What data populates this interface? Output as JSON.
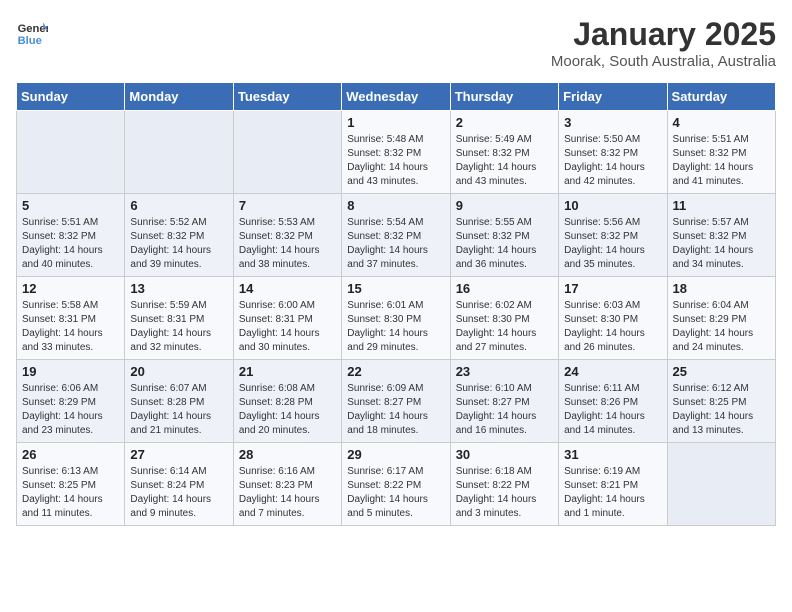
{
  "logo": {
    "line1": "General",
    "line2": "Blue"
  },
  "title": "January 2025",
  "subtitle": "Moorak, South Australia, Australia",
  "headers": [
    "Sunday",
    "Monday",
    "Tuesday",
    "Wednesday",
    "Thursday",
    "Friday",
    "Saturday"
  ],
  "weeks": [
    [
      {
        "day": "",
        "info": ""
      },
      {
        "day": "",
        "info": ""
      },
      {
        "day": "",
        "info": ""
      },
      {
        "day": "1",
        "info": "Sunrise: 5:48 AM\nSunset: 8:32 PM\nDaylight: 14 hours and 43 minutes."
      },
      {
        "day": "2",
        "info": "Sunrise: 5:49 AM\nSunset: 8:32 PM\nDaylight: 14 hours and 43 minutes."
      },
      {
        "day": "3",
        "info": "Sunrise: 5:50 AM\nSunset: 8:32 PM\nDaylight: 14 hours and 42 minutes."
      },
      {
        "day": "4",
        "info": "Sunrise: 5:51 AM\nSunset: 8:32 PM\nDaylight: 14 hours and 41 minutes."
      }
    ],
    [
      {
        "day": "5",
        "info": "Sunrise: 5:51 AM\nSunset: 8:32 PM\nDaylight: 14 hours and 40 minutes."
      },
      {
        "day": "6",
        "info": "Sunrise: 5:52 AM\nSunset: 8:32 PM\nDaylight: 14 hours and 39 minutes."
      },
      {
        "day": "7",
        "info": "Sunrise: 5:53 AM\nSunset: 8:32 PM\nDaylight: 14 hours and 38 minutes."
      },
      {
        "day": "8",
        "info": "Sunrise: 5:54 AM\nSunset: 8:32 PM\nDaylight: 14 hours and 37 minutes."
      },
      {
        "day": "9",
        "info": "Sunrise: 5:55 AM\nSunset: 8:32 PM\nDaylight: 14 hours and 36 minutes."
      },
      {
        "day": "10",
        "info": "Sunrise: 5:56 AM\nSunset: 8:32 PM\nDaylight: 14 hours and 35 minutes."
      },
      {
        "day": "11",
        "info": "Sunrise: 5:57 AM\nSunset: 8:32 PM\nDaylight: 14 hours and 34 minutes."
      }
    ],
    [
      {
        "day": "12",
        "info": "Sunrise: 5:58 AM\nSunset: 8:31 PM\nDaylight: 14 hours and 33 minutes."
      },
      {
        "day": "13",
        "info": "Sunrise: 5:59 AM\nSunset: 8:31 PM\nDaylight: 14 hours and 32 minutes."
      },
      {
        "day": "14",
        "info": "Sunrise: 6:00 AM\nSunset: 8:31 PM\nDaylight: 14 hours and 30 minutes."
      },
      {
        "day": "15",
        "info": "Sunrise: 6:01 AM\nSunset: 8:30 PM\nDaylight: 14 hours and 29 minutes."
      },
      {
        "day": "16",
        "info": "Sunrise: 6:02 AM\nSunset: 8:30 PM\nDaylight: 14 hours and 27 minutes."
      },
      {
        "day": "17",
        "info": "Sunrise: 6:03 AM\nSunset: 8:30 PM\nDaylight: 14 hours and 26 minutes."
      },
      {
        "day": "18",
        "info": "Sunrise: 6:04 AM\nSunset: 8:29 PM\nDaylight: 14 hours and 24 minutes."
      }
    ],
    [
      {
        "day": "19",
        "info": "Sunrise: 6:06 AM\nSunset: 8:29 PM\nDaylight: 14 hours and 23 minutes."
      },
      {
        "day": "20",
        "info": "Sunrise: 6:07 AM\nSunset: 8:28 PM\nDaylight: 14 hours and 21 minutes."
      },
      {
        "day": "21",
        "info": "Sunrise: 6:08 AM\nSunset: 8:28 PM\nDaylight: 14 hours and 20 minutes."
      },
      {
        "day": "22",
        "info": "Sunrise: 6:09 AM\nSunset: 8:27 PM\nDaylight: 14 hours and 18 minutes."
      },
      {
        "day": "23",
        "info": "Sunrise: 6:10 AM\nSunset: 8:27 PM\nDaylight: 14 hours and 16 minutes."
      },
      {
        "day": "24",
        "info": "Sunrise: 6:11 AM\nSunset: 8:26 PM\nDaylight: 14 hours and 14 minutes."
      },
      {
        "day": "25",
        "info": "Sunrise: 6:12 AM\nSunset: 8:25 PM\nDaylight: 14 hours and 13 minutes."
      }
    ],
    [
      {
        "day": "26",
        "info": "Sunrise: 6:13 AM\nSunset: 8:25 PM\nDaylight: 14 hours and 11 minutes."
      },
      {
        "day": "27",
        "info": "Sunrise: 6:14 AM\nSunset: 8:24 PM\nDaylight: 14 hours and 9 minutes."
      },
      {
        "day": "28",
        "info": "Sunrise: 6:16 AM\nSunset: 8:23 PM\nDaylight: 14 hours and 7 minutes."
      },
      {
        "day": "29",
        "info": "Sunrise: 6:17 AM\nSunset: 8:22 PM\nDaylight: 14 hours and 5 minutes."
      },
      {
        "day": "30",
        "info": "Sunrise: 6:18 AM\nSunset: 8:22 PM\nDaylight: 14 hours and 3 minutes."
      },
      {
        "day": "31",
        "info": "Sunrise: 6:19 AM\nSunset: 8:21 PM\nDaylight: 14 hours and 1 minute."
      },
      {
        "day": "",
        "info": ""
      }
    ]
  ]
}
